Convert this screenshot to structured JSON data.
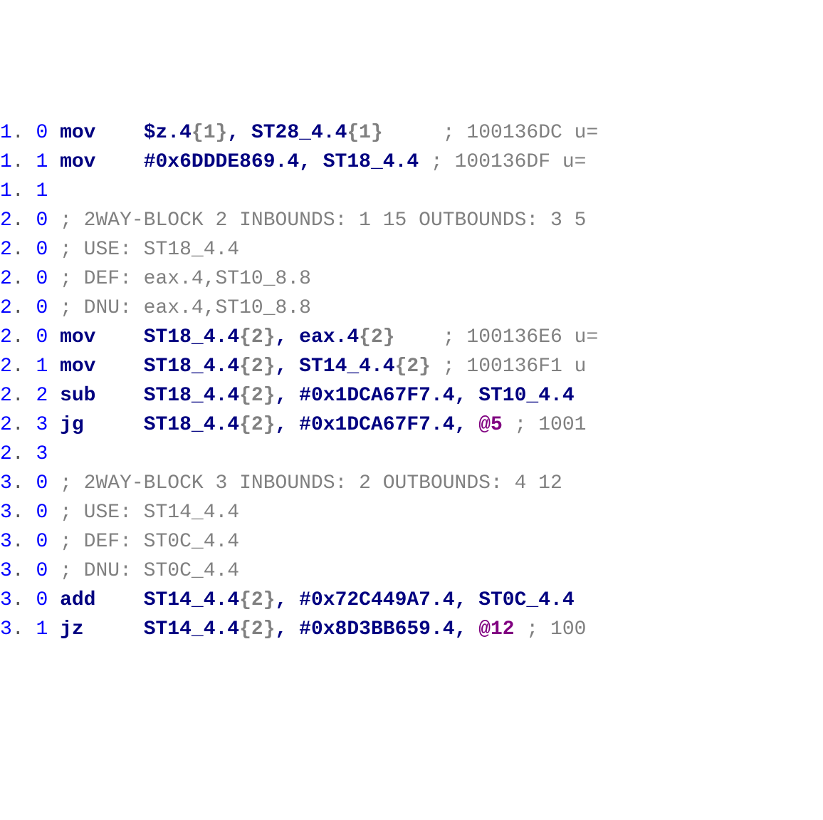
{
  "lines": [
    {
      "blk": "1",
      "idx": "0",
      "type": "instr",
      "mnem": "mov",
      "mpad": "    ",
      "ops": [
        {
          "txt": "$z.4"
        },
        {
          "txt": "{1}",
          "k": "c"
        },
        {
          "txt": ", "
        },
        {
          "txt": "ST28_4.4"
        },
        {
          "txt": "{1}",
          "k": "c"
        }
      ],
      "opad": "     ",
      "cmt": "100136DC u="
    },
    {
      "blk": "1",
      "idx": "1",
      "type": "instr",
      "mnem": "mov",
      "mpad": "    ",
      "ops": [
        {
          "txt": "#0x6DDDE869.4"
        },
        {
          "txt": ", "
        },
        {
          "txt": "ST18_4.4"
        }
      ],
      "opad": " ",
      "cmt": "100136DF u="
    },
    {
      "blk": "1",
      "idx": "1",
      "type": "blank"
    },
    {
      "blk": "2",
      "idx": "0",
      "type": "comment",
      "cmt": "2WAY-BLOCK 2 INBOUNDS: 1 15 OUTBOUNDS: 3 5"
    },
    {
      "blk": "2",
      "idx": "0",
      "type": "comment",
      "cmt": "USE: ST18_4.4"
    },
    {
      "blk": "2",
      "idx": "0",
      "type": "comment",
      "cmt": "DEF: eax.4,ST10_8.8"
    },
    {
      "blk": "2",
      "idx": "0",
      "type": "comment",
      "cmt": "DNU: eax.4,ST10_8.8"
    },
    {
      "blk": "2",
      "idx": "0",
      "type": "instr",
      "mnem": "mov",
      "mpad": "    ",
      "ops": [
        {
          "txt": "ST18_4.4"
        },
        {
          "txt": "{2}",
          "k": "c"
        },
        {
          "txt": ", "
        },
        {
          "txt": "eax.4"
        },
        {
          "txt": "{2}",
          "k": "c"
        }
      ],
      "opad": "    ",
      "cmt": "100136E6 u="
    },
    {
      "blk": "2",
      "idx": "1",
      "type": "instr",
      "mnem": "mov",
      "mpad": "    ",
      "ops": [
        {
          "txt": "ST18_4.4"
        },
        {
          "txt": "{2}",
          "k": "c"
        },
        {
          "txt": ", "
        },
        {
          "txt": "ST14_4.4"
        },
        {
          "txt": "{2}",
          "k": "c"
        }
      ],
      "opad": " ",
      "cmt": "100136F1 u"
    },
    {
      "blk": "2",
      "idx": "2",
      "type": "instr",
      "mnem": "sub",
      "mpad": "    ",
      "ops": [
        {
          "txt": "ST18_4.4"
        },
        {
          "txt": "{2}",
          "k": "c"
        },
        {
          "txt": ", "
        },
        {
          "txt": "#0x1DCA67F7.4"
        },
        {
          "txt": ", "
        },
        {
          "txt": "ST10_4.4 "
        }
      ]
    },
    {
      "blk": "2",
      "idx": "3",
      "type": "instr",
      "mnem": "jg",
      "mpad": "     ",
      "ops": [
        {
          "txt": "ST18_4.4"
        },
        {
          "txt": "{2}",
          "k": "c"
        },
        {
          "txt": ", "
        },
        {
          "txt": "#0x1DCA67F7.4"
        },
        {
          "txt": ", "
        },
        {
          "txt": "@5",
          "k": "l"
        }
      ],
      "opad": " ",
      "cmt": "1001"
    },
    {
      "blk": "2",
      "idx": "3",
      "type": "blank"
    },
    {
      "blk": "3",
      "idx": "0",
      "type": "comment",
      "cmt": "2WAY-BLOCK 3 INBOUNDS: 2 OUTBOUNDS: 4 12 "
    },
    {
      "blk": "3",
      "idx": "0",
      "type": "comment",
      "cmt": "USE: ST14_4.4"
    },
    {
      "blk": "3",
      "idx": "0",
      "type": "comment",
      "cmt": "DEF: ST0C_4.4"
    },
    {
      "blk": "3",
      "idx": "0",
      "type": "comment",
      "cmt": "DNU: ST0C_4.4"
    },
    {
      "blk": "3",
      "idx": "0",
      "type": "instr",
      "mnem": "add",
      "mpad": "    ",
      "ops": [
        {
          "txt": "ST14_4.4"
        },
        {
          "txt": "{2}",
          "k": "c"
        },
        {
          "txt": ", "
        },
        {
          "txt": "#0x72C449A7.4"
        },
        {
          "txt": ", "
        },
        {
          "txt": "ST0C_4.4 "
        }
      ]
    },
    {
      "blk": "3",
      "idx": "1",
      "type": "instr",
      "mnem": "jz",
      "mpad": "     ",
      "ops": [
        {
          "txt": "ST14_4.4"
        },
        {
          "txt": "{2}",
          "k": "c"
        },
        {
          "txt": ", "
        },
        {
          "txt": "#0x8D3BB659.4"
        },
        {
          "txt": ", "
        },
        {
          "txt": "@12",
          "k": "l"
        }
      ],
      "opad": " ",
      "cmt": "100"
    }
  ]
}
